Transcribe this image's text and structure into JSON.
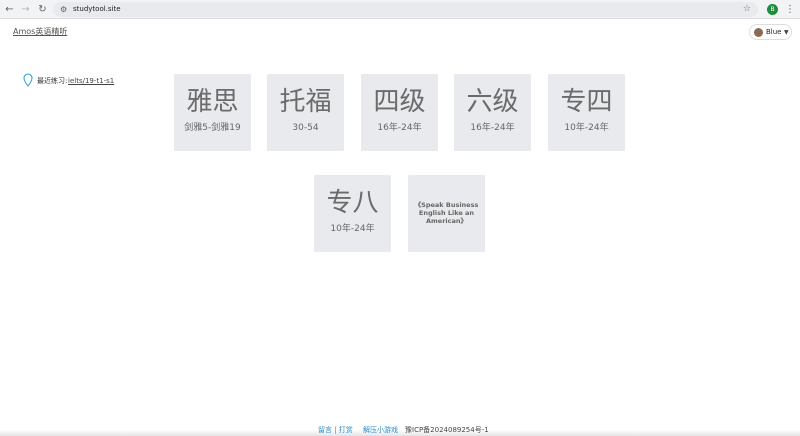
{
  "browser": {
    "url": "studytool.site",
    "profile_initial": "B"
  },
  "header": {
    "brand": "Amos英语精听",
    "theme_label": "Blue"
  },
  "recent": {
    "label": "最近练习:",
    "link": "ielts/19-t1-s1"
  },
  "cards": [
    {
      "title": "雅思",
      "sub": "剑雅5-剑雅19"
    },
    {
      "title": "托福",
      "sub": "30-54"
    },
    {
      "title": "四级",
      "sub": "16年-24年"
    },
    {
      "title": "六级",
      "sub": "16年-24年"
    },
    {
      "title": "专四",
      "sub": "10年-24年"
    },
    {
      "title": "专八",
      "sub": "10年-24年"
    },
    {
      "title": "",
      "sub": "",
      "text": "《Speak Business English Like an American》"
    }
  ],
  "footer": {
    "links": "留言 | 打赏",
    "game": "解压小游戏",
    "icp": "豫ICP备2024089254号-1"
  }
}
